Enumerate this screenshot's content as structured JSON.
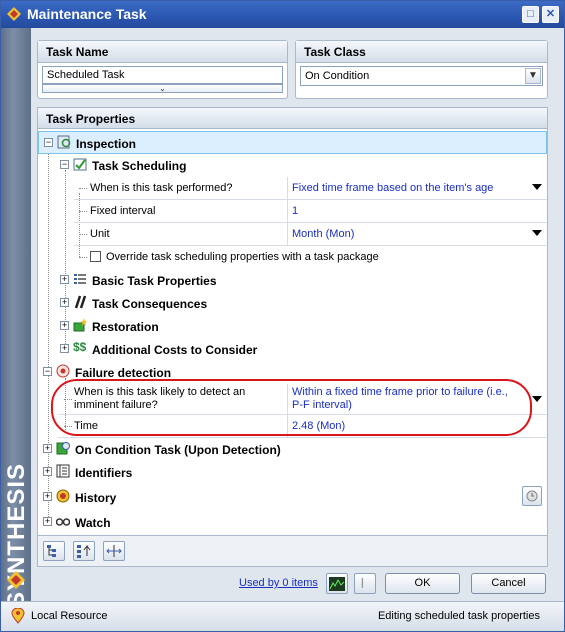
{
  "window": {
    "title": "Maintenance Task",
    "brand": "SYNTHESIS"
  },
  "task_name": {
    "header": "Task Name",
    "value": "Scheduled Task"
  },
  "task_class": {
    "header": "Task Class",
    "value": "On Condition"
  },
  "props": {
    "header": "Task Properties",
    "inspection": "Inspection",
    "task_scheduling": "Task Scheduling",
    "when_performed_label": "When is this task performed?",
    "when_performed_value": "Fixed time frame based on the item's age",
    "fixed_interval_label": "Fixed interval",
    "fixed_interval_value": "1",
    "unit_label": "Unit",
    "unit_value": "Month (Mon)",
    "override_label": "Override task scheduling properties with a task package",
    "basic_props": "Basic Task Properties",
    "consequences": "Task Consequences",
    "restoration": "Restoration",
    "additional_costs": "Additional Costs to Consider",
    "failure_detection": "Failure detection",
    "detect_label_1": "When is this task likely to detect an",
    "detect_label_2": "imminent failure?",
    "detect_value_1": "Within a fixed time frame prior to failure (i.e.,",
    "detect_value_2": "P-F interval)",
    "time_label": "Time",
    "time_value": "2.48 (Mon)",
    "on_condition": "On Condition Task (Upon Detection)",
    "identifiers": "Identifiers",
    "history": "History",
    "watch": "Watch"
  },
  "footer": {
    "used_by": "Used by 0 items",
    "ok": "OK",
    "cancel": "Cancel"
  },
  "status": {
    "left": "Local Resource",
    "right": "Editing scheduled task properties"
  },
  "colors": {
    "value_blue": "#1a2ec0",
    "highlight_red": "#d9161c",
    "title_blue": "#2a56b0"
  }
}
